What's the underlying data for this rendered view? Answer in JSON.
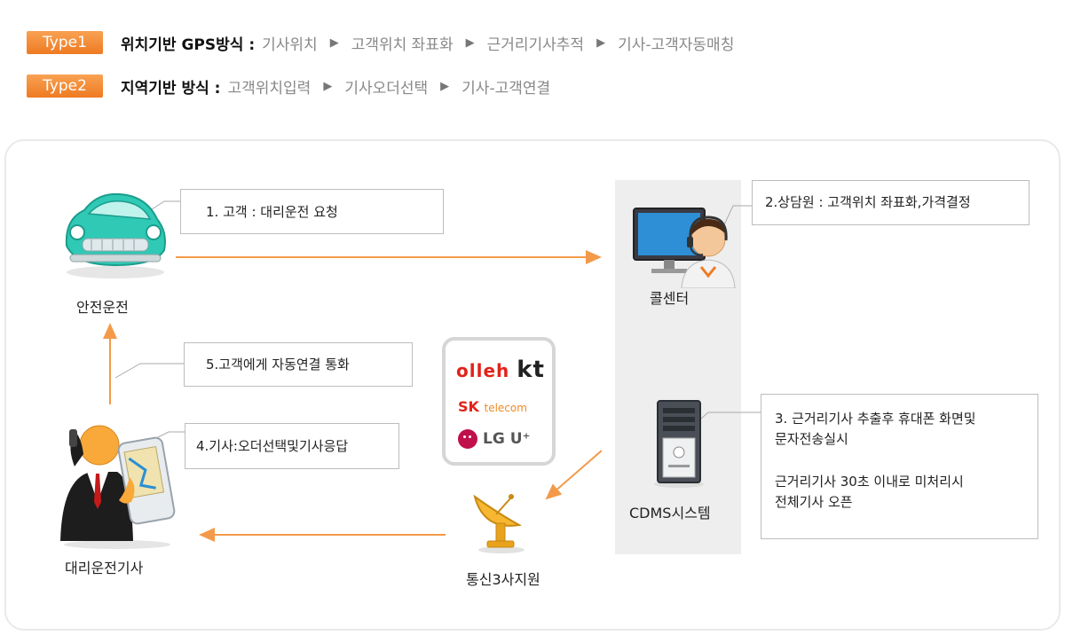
{
  "type1": {
    "badge": "Type1",
    "title": "위치기반 GPS방식 :",
    "steps": [
      "기사위치",
      "고객위치 좌표화",
      "근거리기사추적",
      "기사-고객자동매칭"
    ]
  },
  "type2": {
    "badge": "Type2",
    "title": "지역기반 방식 :",
    "steps": [
      "고객위치입력",
      "기사오더선택",
      "기사-고객연결"
    ]
  },
  "arrow_glyph": "▶",
  "diagram": {
    "car_label": "안전운전",
    "callcenter_label": "콜센터",
    "cdms_label": "CDMS시스템",
    "driver_label": "대리운전기사",
    "telecom_label": "통신3사지원",
    "step1": "1. 고객 : 대리운전 요청",
    "step2": "2.상담원 : 고객위치 좌표화,가격결정",
    "step3_line1": "3. 근거리기사 추출후 휴대폰 화면및",
    "step3_line2": "문자전송실시",
    "step3_line3": "근거리기사 30초 이내로 미처리시",
    "step3_line4": "전체기사 오픈",
    "step4": "4.기사:오더선택및기사응답",
    "step5": "5.고객에게 자동연결 통화"
  },
  "telecom": {
    "olleh": "olleh",
    "kt": "kt",
    "sk": "SK",
    "sk_telecom": "telecom",
    "lg": "LG U⁺"
  },
  "colors": {
    "accent_orange": "#f39a4a",
    "badge_orange": "#ee7a22",
    "car_teal": "#2fc9b5"
  },
  "icons": [
    "car-icon",
    "callcenter-agent-icon",
    "server-tower-icon",
    "satellite-dish-icon",
    "driver-phone-icon"
  ]
}
